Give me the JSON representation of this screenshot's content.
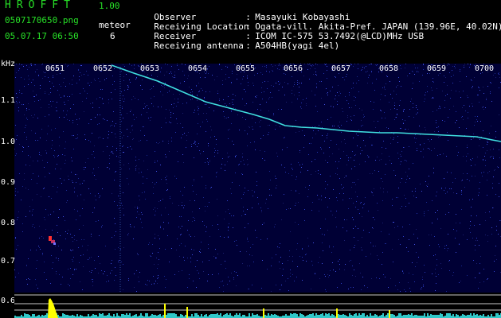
{
  "header": {
    "app_title": "HROFFT",
    "version": "1.00",
    "file_name": "0507170650.png",
    "datetime": "05.07.17 06:50",
    "meteor_label": "meteor",
    "meteor_count": "6"
  },
  "info": [
    {
      "key": "Observer",
      "sep": ":",
      "value": "Masayuki Kobayashi"
    },
    {
      "key": "Receiving Location",
      "sep": ":",
      "value": "Ogata-vill. Akita-Pref. JAPAN (139.96E, 40.02N)"
    },
    {
      "key": "Receiver",
      "sep": ":",
      "value": "ICOM IC-575 53.7492(@LCD)MHz USB"
    },
    {
      "key": "Receiving antenna",
      "sep": ":",
      "value": "A504HB(yagi 4el)"
    }
  ],
  "axis": {
    "unit": "kHz",
    "y_labels": [
      "1.1",
      "1.0",
      "0.9",
      "0.8",
      "0.7",
      "0.6"
    ],
    "time_labels": [
      "0651",
      "0652",
      "0653",
      "0654",
      "0655",
      "0656",
      "0657",
      "0658",
      "0659",
      "0700"
    ]
  },
  "colors": {
    "title_green": "#27e027",
    "trace": "#40e0e0",
    "background": "#000035",
    "meteor_red": "#ff3030",
    "peak_yellow": "#ffff00"
  }
}
